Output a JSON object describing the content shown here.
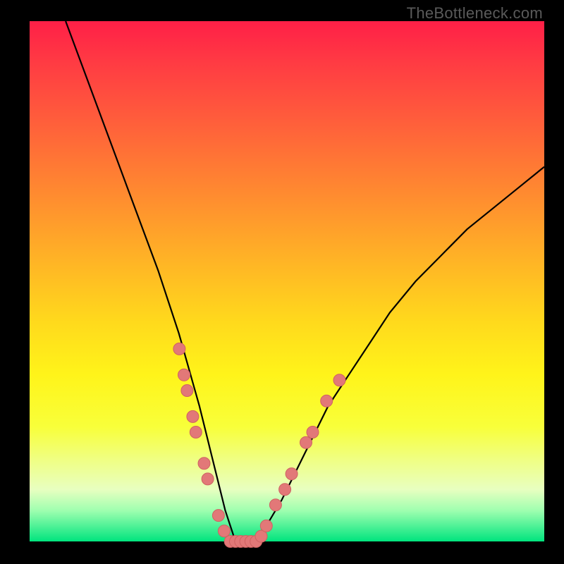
{
  "watermark": "TheBottleneck.com",
  "colors": {
    "frame": "#000000",
    "curve": "#000000",
    "dot_fill": "#e27878",
    "dot_stroke": "#cf6262"
  },
  "chart_data": {
    "type": "line",
    "title": "",
    "xlabel": "",
    "ylabel": "",
    "xlim": [
      0,
      100
    ],
    "ylim": [
      0,
      100
    ],
    "grid": false,
    "legend": false,
    "series": [
      {
        "name": "bottleneck-curve",
        "x": [
          7,
          10,
          13,
          16,
          19,
          22,
          25,
          27,
          29,
          31,
          33,
          34,
          35,
          36,
          37,
          38,
          39,
          40,
          43,
          46,
          49,
          52,
          55,
          58,
          62,
          66,
          70,
          75,
          80,
          85,
          90,
          95,
          100
        ],
        "y": [
          100,
          92,
          84,
          76,
          68,
          60,
          52,
          46,
          40,
          33,
          26,
          22,
          18,
          14,
          10,
          6,
          3,
          0,
          0,
          3,
          8,
          14,
          20,
          26,
          32,
          38,
          44,
          50,
          55,
          60,
          64,
          68,
          72
        ]
      }
    ],
    "markers": [
      {
        "x": 29.1,
        "y": 37
      },
      {
        "x": 30.0,
        "y": 32
      },
      {
        "x": 30.6,
        "y": 29
      },
      {
        "x": 31.7,
        "y": 24
      },
      {
        "x": 32.3,
        "y": 21
      },
      {
        "x": 33.9,
        "y": 15
      },
      {
        "x": 34.6,
        "y": 12
      },
      {
        "x": 36.7,
        "y": 5
      },
      {
        "x": 37.8,
        "y": 2
      },
      {
        "x": 39.0,
        "y": 0
      },
      {
        "x": 40.0,
        "y": 0
      },
      {
        "x": 41.0,
        "y": 0
      },
      {
        "x": 42.0,
        "y": 0
      },
      {
        "x": 43.0,
        "y": 0
      },
      {
        "x": 44.0,
        "y": 0
      },
      {
        "x": 45.0,
        "y": 1
      },
      {
        "x": 46.0,
        "y": 3
      },
      {
        "x": 47.8,
        "y": 7
      },
      {
        "x": 49.6,
        "y": 10
      },
      {
        "x": 50.9,
        "y": 13
      },
      {
        "x": 53.7,
        "y": 19
      },
      {
        "x": 55.0,
        "y": 21
      },
      {
        "x": 57.7,
        "y": 27
      },
      {
        "x": 60.2,
        "y": 31
      }
    ]
  }
}
